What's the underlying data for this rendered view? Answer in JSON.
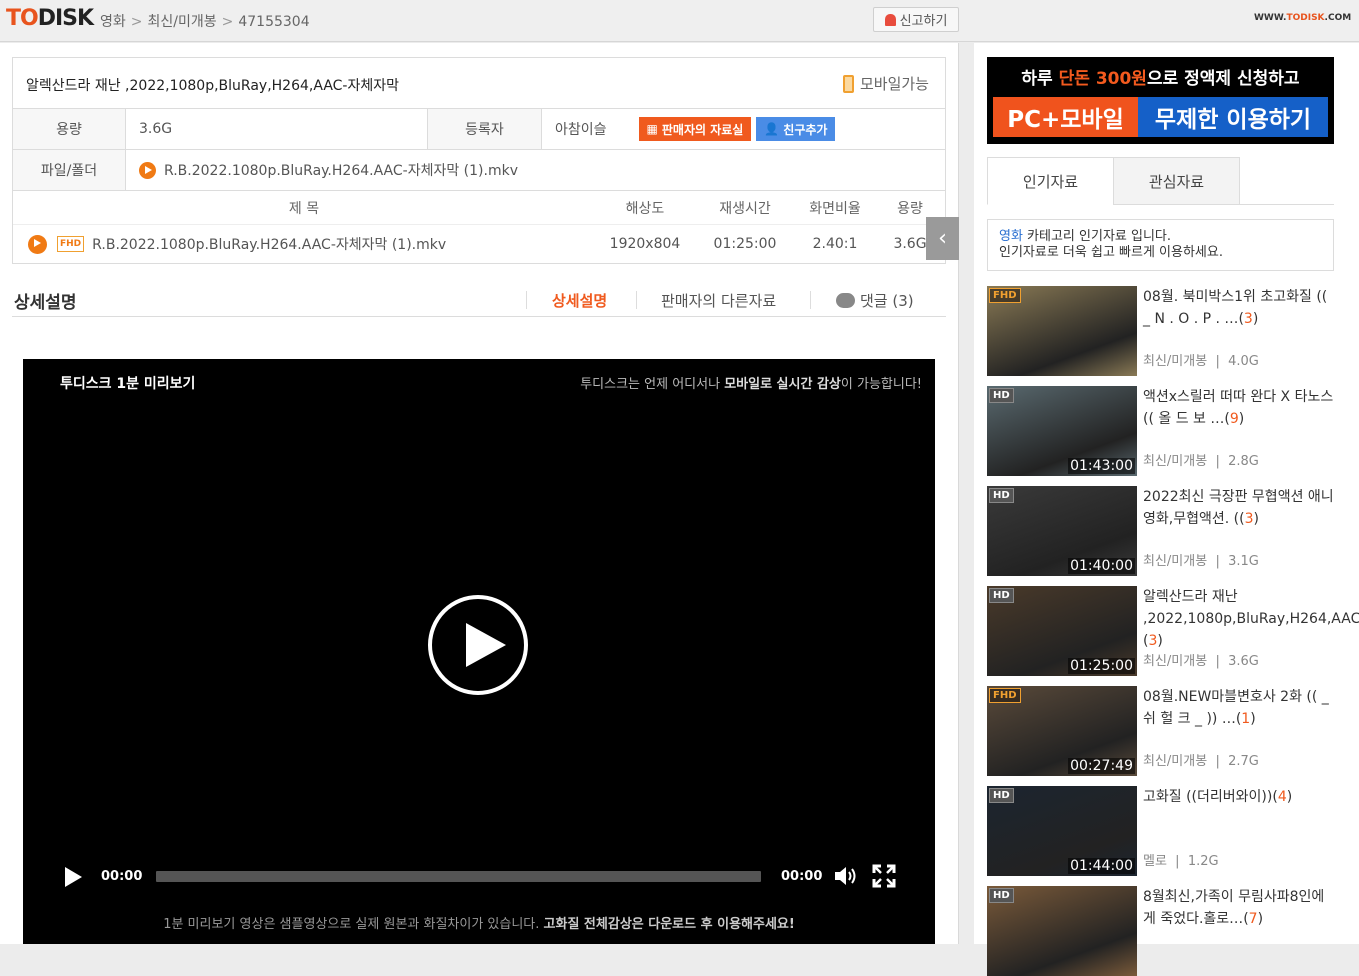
{
  "header": {
    "logo_to": "TO",
    "logo_disk": "DISK",
    "breadcrumbs": [
      "영화",
      "최신/미개봉",
      "47155304"
    ],
    "report_label": "신고하기",
    "site_url_pre": "WWW.",
    "site_url_brand": "TODISK",
    "site_url_post": ".COM"
  },
  "file_info": {
    "title": "알렉산드라 재난 ,2022,1080p,BluRay,H264,AAC-자체자막",
    "mobile_label": "모바일가능",
    "size_label": "용량",
    "size_value": "3.6G",
    "uploader_label": "등록자",
    "uploader_value": "아참이슬",
    "seller_btn": "판매자의 자료실",
    "friend_btn": "친구추가",
    "file_label": "파일/폴더",
    "file_value": "R.B.2022.1080p.BluRay.H264.AAC-자체자막 (1).mkv"
  },
  "file_list": {
    "headers": {
      "title": "제  목",
      "resolution": "해상도",
      "duration": "재생시간",
      "ratio": "화면비율",
      "size": "용량"
    },
    "row": {
      "badge": "FHD",
      "name": "R.B.2022.1080p.BluRay.H264.AAC-자체자막 (1).mkv",
      "resolution": "1920x804",
      "duration": "01:25:00",
      "ratio": "2.40:1",
      "size": "3.6G"
    }
  },
  "detail": {
    "title": "상세설명",
    "tabs": [
      "상세설명",
      "판매자의 다른자료",
      "댓글 (3)"
    ]
  },
  "video": {
    "top_left": "투디스크 1분 미리보기",
    "top_right_pre": "투디스크는 언제 어디서나 ",
    "top_right_bold": "모바일로 실시간 감상",
    "top_right_post": "이 가능합니다!",
    "time_current": "00:00",
    "time_total": "00:00",
    "bottom_pre": "1분 미리보기 영상은 샘플영상으로 실제 원본과 화질차이가 있습니다. ",
    "bottom_bold": "고화질 전체감상은 다운로드 후 이용해주세요!"
  },
  "banner": {
    "line1_pre": "하루 ",
    "line1_accent": "단돈 300원",
    "line1_post": "으로 정액제 신청하고",
    "line2_a": "PC+모바일",
    "line2_b": "무제한 이용하기"
  },
  "sidebar": {
    "tabs": [
      "인기자료",
      "관심자료"
    ],
    "notice_cat": "영화",
    "notice_line1_post": " 카테고리 인기자료 입니다.",
    "notice_line2": "인기자료로 더욱 쉽고 빠르게 이용하세요.",
    "items": [
      {
        "badge": "FHD",
        "duration": "",
        "title": "08월. 북미박스1위 초고화질 (( _ N . O . P . …",
        "count": "3",
        "category": "최신/미개봉",
        "size": "4.0G",
        "thumb": "#8a7a55"
      },
      {
        "badge": "HD",
        "duration": "01:43:00",
        "title": "액션x스릴러 떠따 완다 X 타노스 (( 올 드 보 …",
        "count": "9",
        "category": "최신/미개봉",
        "size": "2.8G",
        "thumb": "#5a6a70"
      },
      {
        "badge": "HD",
        "duration": "01:40:00",
        "title": "2022최신 극장판 무협액션 애니영화,무협액션. (",
        "count": "3",
        "category": "최신/미개봉",
        "size": "3.1G",
        "thumb": "#3a3a3a"
      },
      {
        "badge": "HD",
        "duration": "01:25:00",
        "title": "알렉산드라 재난 ,2022,1080p,BluRay,H264,AAC…",
        "count": "3",
        "category": "최신/미개봉",
        "size": "3.6G",
        "thumb": "#4a3a2a"
      },
      {
        "badge": "FHD",
        "duration": "00:27:49",
        "title": "08월.NEW마블변호사 2화 (( _ 쉬 헐 크 _ )) …",
        "count": "1",
        "category": "최신/미개봉",
        "size": "2.7G",
        "thumb": "#5a4a3a"
      },
      {
        "badge": "HD",
        "duration": "01:44:00",
        "title": "고화질 ((더리버와이))",
        "count": "4",
        "category": "멜로",
        "size": "1.2G",
        "thumb": "#1c2530"
      },
      {
        "badge": "HD",
        "duration": "",
        "title": "8월최신,가족이 무림사파8인에게 죽었다.홀로…",
        "count": "7",
        "category": "",
        "size": "",
        "thumb": "#7a5a3a"
      }
    ]
  }
}
